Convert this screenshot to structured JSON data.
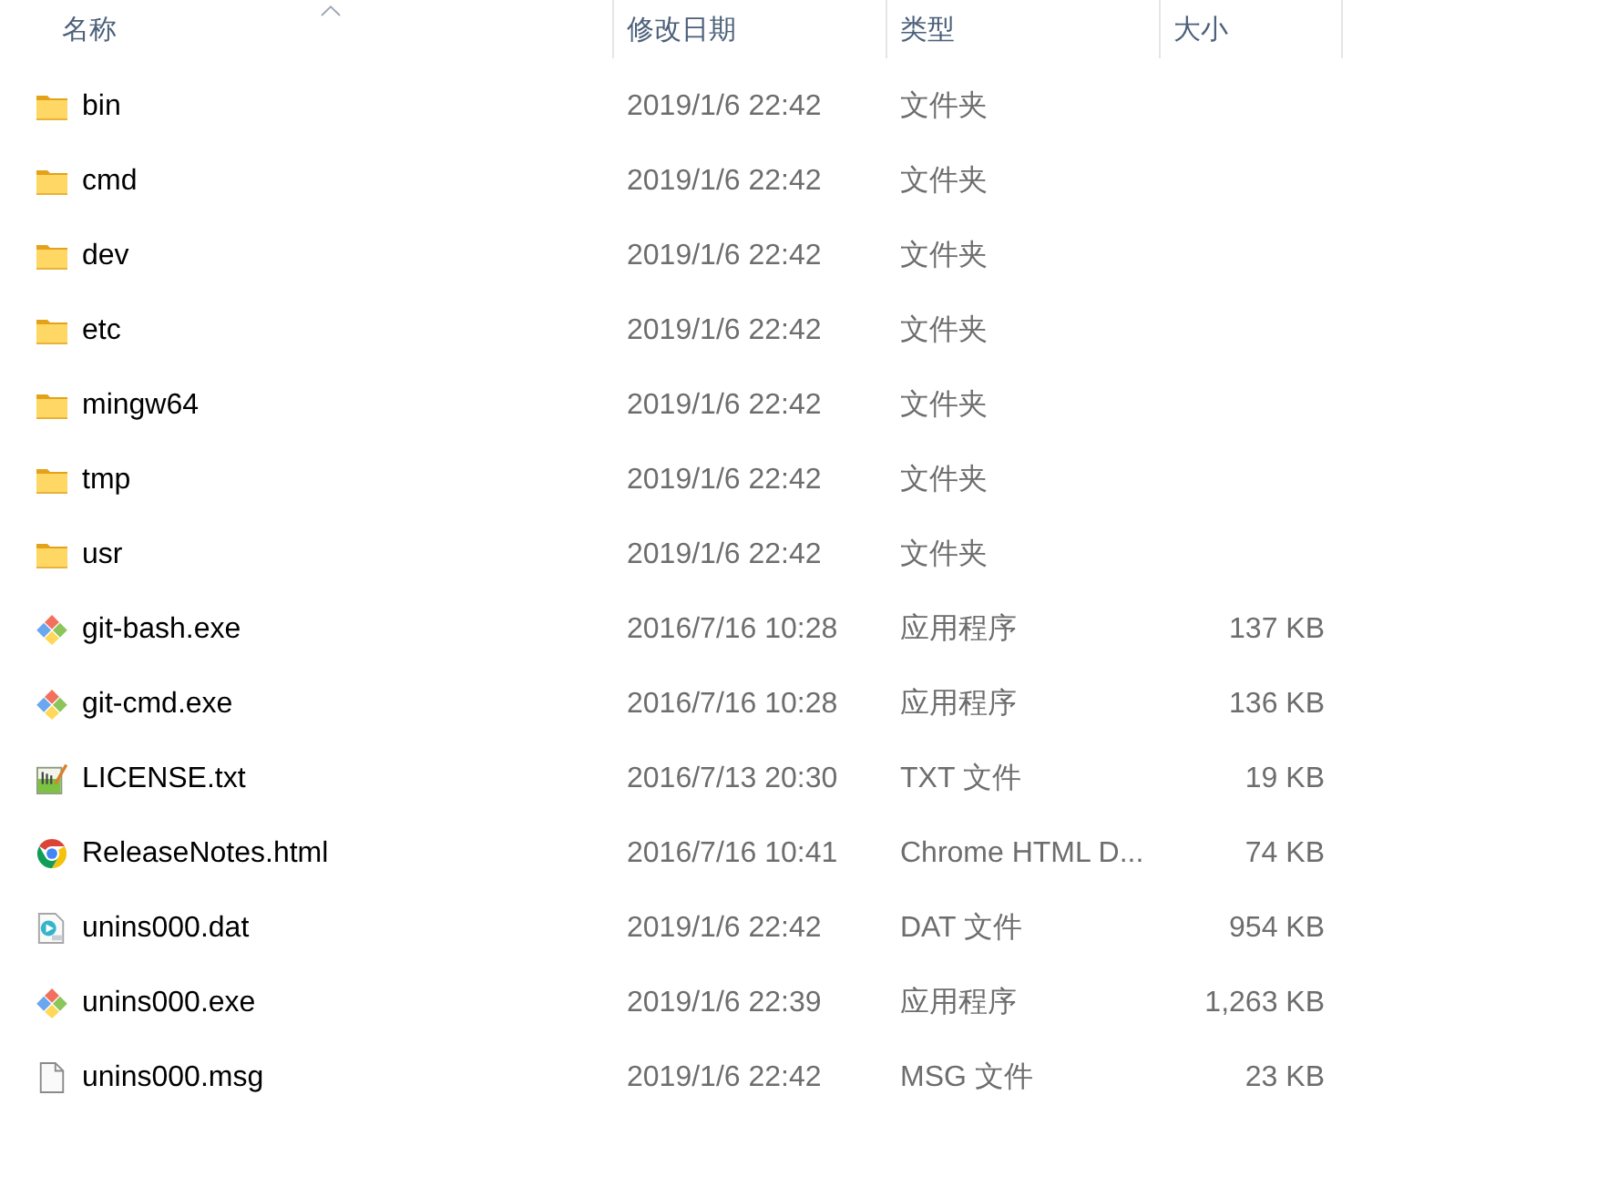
{
  "columns": [
    {
      "label": "名称",
      "sorted": true
    },
    {
      "label": "修改日期",
      "sorted": false
    },
    {
      "label": "类型",
      "sorted": false
    },
    {
      "label": "大小",
      "sorted": false
    }
  ],
  "files": [
    {
      "kind": "folder",
      "name": "bin",
      "modified": "2019/1/6 22:42",
      "type": "文件夹"
    },
    {
      "kind": "folder",
      "name": "cmd",
      "modified": "2019/1/6 22:42",
      "type": "文件夹"
    },
    {
      "kind": "folder",
      "name": "dev",
      "modified": "2019/1/6 22:42",
      "type": "文件夹"
    },
    {
      "kind": "folder",
      "name": "etc",
      "modified": "2019/1/6 22:42",
      "type": "文件夹"
    },
    {
      "kind": "folder",
      "name": "mingw64",
      "modified": "2019/1/6 22:42",
      "type": "文件夹"
    },
    {
      "kind": "folder",
      "name": "tmp",
      "modified": "2019/1/6 22:42",
      "type": "文件夹"
    },
    {
      "kind": "folder",
      "name": "usr",
      "modified": "2019/1/6 22:42",
      "type": "文件夹"
    },
    {
      "kind": "diamond",
      "name": "git-bash.exe",
      "modified": "2016/7/16 10:28",
      "type": "应用程序",
      "size": "137 KB"
    },
    {
      "kind": "diamond",
      "name": "git-cmd.exe",
      "modified": "2016/7/16 10:28",
      "type": "应用程序",
      "size": "136 KB"
    },
    {
      "kind": "text",
      "name": "LICENSE.txt",
      "modified": "2016/7/13 20:30",
      "type": "TXT 文件",
      "size": "19 KB"
    },
    {
      "kind": "browser",
      "name": "ReleaseNotes.html",
      "modified": "2016/7/16 10:41",
      "type": "Chrome HTML D...",
      "size": "74 KB"
    },
    {
      "kind": "video",
      "name": "unins000.dat",
      "modified": "2019/1/6 22:42",
      "type": "DAT 文件",
      "size": "954 KB"
    },
    {
      "kind": "diamond",
      "name": "unins000.exe",
      "modified": "2019/1/6 22:39",
      "type": "应用程序",
      "size": "1,263 KB"
    },
    {
      "kind": "blank",
      "name": "unins000.msg",
      "modified": "2019/1/6 22:42",
      "type": "MSG 文件",
      "size": "23 KB"
    }
  ]
}
